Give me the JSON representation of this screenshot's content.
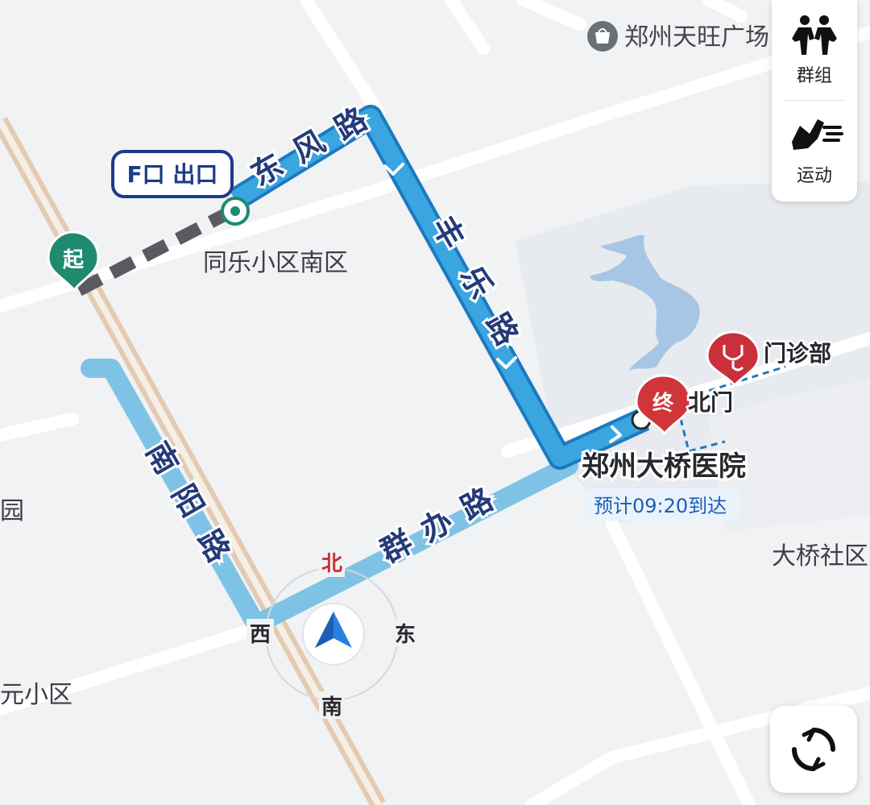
{
  "map": {
    "poi_top": "郑州天旺广场",
    "exit_tag": "F口 出口",
    "start_marker": "起",
    "end_marker": "终",
    "community_tongle": "同乐小区南区",
    "clinic_label": "门诊部",
    "north_gate": "北门",
    "destination_name": "郑州大桥医院",
    "eta": "预计09:20到达",
    "daqiao_community": "大桥社区",
    "left_partial_1": "园",
    "left_partial_2": "元小区"
  },
  "roads": {
    "dongfeng": [
      "东",
      "风",
      "路"
    ],
    "fengle": [
      "丰",
      "乐",
      "路"
    ],
    "nanyang": [
      "南",
      "阳",
      "路"
    ],
    "qunban": [
      "群",
      "办",
      "路"
    ]
  },
  "compass": {
    "north": "北",
    "south": "南",
    "east": "东",
    "west": "西"
  },
  "side_panel": {
    "group_label": "群组",
    "sport_label": "运动"
  },
  "colors": {
    "route": "#3aa5e0",
    "route_edge": "#1c79c0",
    "route_pale": "#7ec3e6",
    "walk_dashes": "#5a5a62",
    "start_marker": "#1f8a70",
    "end_marker": "#d0353a",
    "exit_tag_border": "#1d3b8a",
    "compass_arrow": "#2a7fdc"
  }
}
